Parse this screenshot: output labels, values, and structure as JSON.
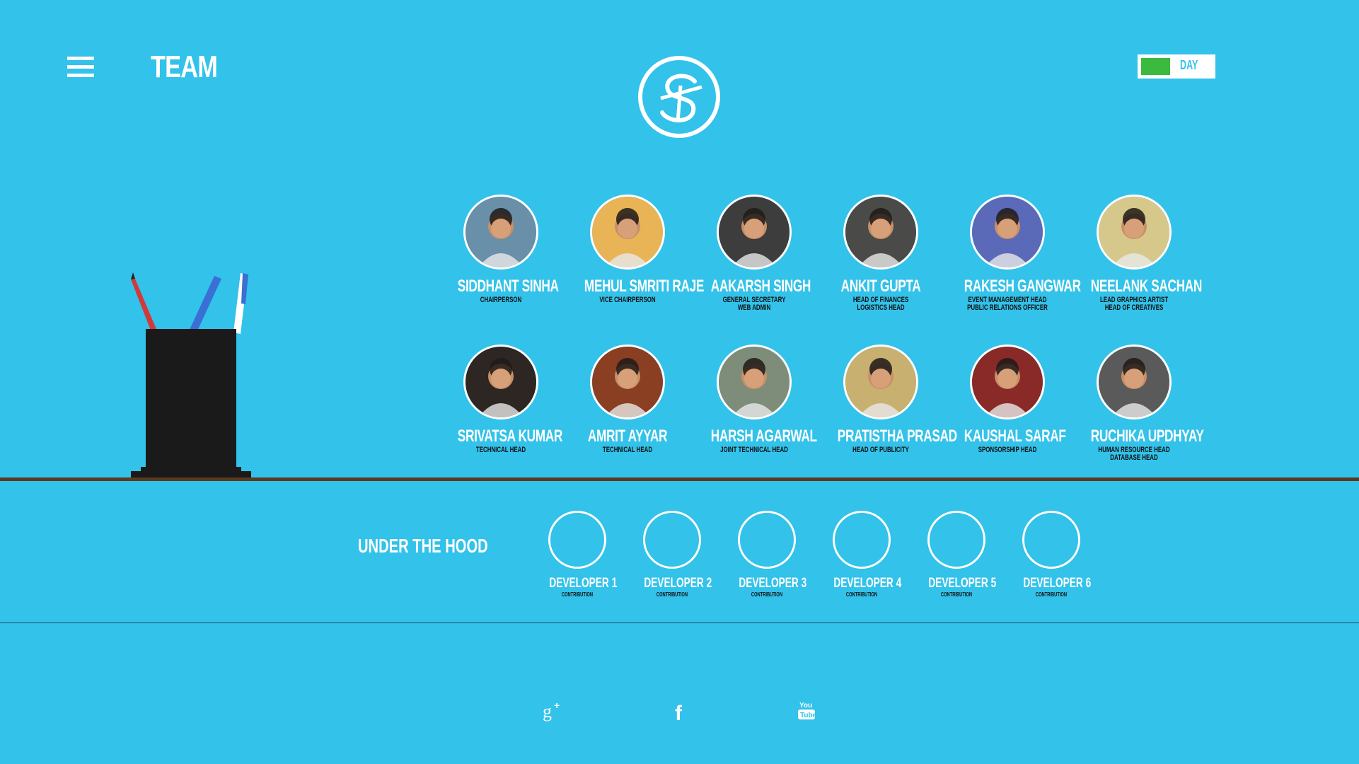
{
  "header": {
    "title": "TEAM",
    "toggle_label": "DAY"
  },
  "team": [
    {
      "name": "SIDDHANT SINHA",
      "roles": [
        "CHAIRPERSON"
      ],
      "photo_color": "#6a8fa8"
    },
    {
      "name": "MEHUL SMRITI RAJE",
      "roles": [
        "VICE CHAIRPERSON"
      ],
      "photo_color": "#e8b455"
    },
    {
      "name": "AAKARSH SINGH",
      "roles": [
        "GENERAL SECRETARY",
        "WEB ADMIN"
      ],
      "photo_color": "#3d3d3d"
    },
    {
      "name": "ANKIT GUPTA",
      "roles": [
        "HEAD OF FINANCES",
        "LOGISTICS HEAD"
      ],
      "photo_color": "#4a4a48"
    },
    {
      "name": "RAKESH GANGWAR",
      "roles": [
        "EVENT MANAGEMENT HEAD",
        "PUBLIC RELATIONS OFFICER"
      ],
      "photo_color": "#5a6ab8"
    },
    {
      "name": "NEELANK SACHAN",
      "roles": [
        "LEAD GRAPHICS ARTIST",
        "HEAD OF CREATIVES"
      ],
      "photo_color": "#d6c88a"
    },
    {
      "name": "SRIVATSA KUMAR",
      "roles": [
        "TECHNICAL HEAD"
      ],
      "photo_color": "#2e2622"
    },
    {
      "name": "AMRIT AYYAR",
      "roles": [
        "TECHNICAL HEAD"
      ],
      "photo_color": "#8a3e22"
    },
    {
      "name": "HARSH AGARWAL",
      "roles": [
        "JOINT TECHNICAL HEAD"
      ],
      "photo_color": "#7d8d7a"
    },
    {
      "name": "PRATISTHA PRASAD",
      "roles": [
        "HEAD OF PUBLICITY"
      ],
      "photo_color": "#c8b070"
    },
    {
      "name": "KAUSHAL SARAF",
      "roles": [
        "SPONSORSHIP HEAD"
      ],
      "photo_color": "#8a2a28"
    },
    {
      "name": "RUCHIKA UPDHYAY",
      "roles": [
        "HUMAN RESOURCE HEAD",
        "DATABASE HEAD"
      ],
      "photo_color": "#5a5a5a"
    }
  ],
  "under_the_hood": {
    "title": "UNDER THE HOOD",
    "developers": [
      {
        "name": "DEVELOPER 1",
        "role": "CONTRIBUTION"
      },
      {
        "name": "DEVELOPER 2",
        "role": "CONTRIBUTION"
      },
      {
        "name": "DEVELOPER 3",
        "role": "CONTRIBUTION"
      },
      {
        "name": "DEVELOPER 4",
        "role": "CONTRIBUTION"
      },
      {
        "name": "DEVELOPER 5",
        "role": "CONTRIBUTION"
      },
      {
        "name": "DEVELOPER 6",
        "role": "CONTRIBUTION"
      }
    ]
  },
  "social": [
    {
      "icon": "google-plus-icon",
      "glyph": "g+"
    },
    {
      "icon": "facebook-icon",
      "glyph": "f"
    },
    {
      "icon": "youtube-icon",
      "glyph": "You Tube"
    }
  ],
  "colors": {
    "background": "#32c2ea",
    "shelf": "#5b3a1e",
    "toggle_on": "#3bba3f"
  }
}
